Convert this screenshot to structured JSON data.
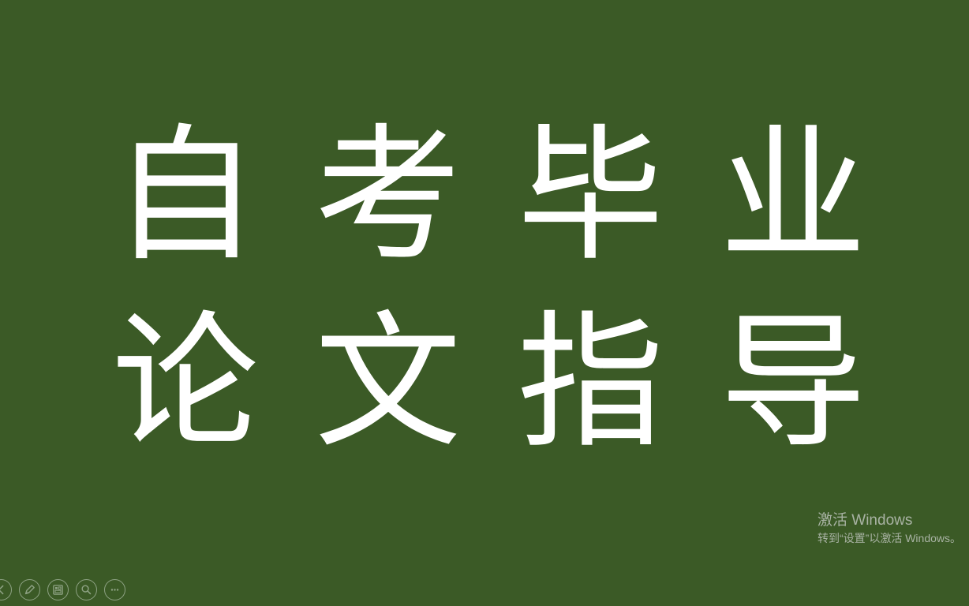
{
  "slide": {
    "title_line1": [
      "自",
      "考",
      "毕",
      "业"
    ],
    "title_line2": [
      "论",
      "文",
      "指",
      "导"
    ]
  },
  "watermark": {
    "title": "激活 Windows",
    "subtitle": "转到“设置”以激活 Windows。"
  },
  "toolbar": {
    "icons": [
      "previous-icon",
      "pen-icon",
      "slides-grid-icon",
      "zoom-icon",
      "more-icon"
    ]
  },
  "colors": {
    "background": "#3b5a26",
    "text": "#ffffff",
    "watermark": "#a9b3a4",
    "toolbar_icon": "#8ea284"
  }
}
